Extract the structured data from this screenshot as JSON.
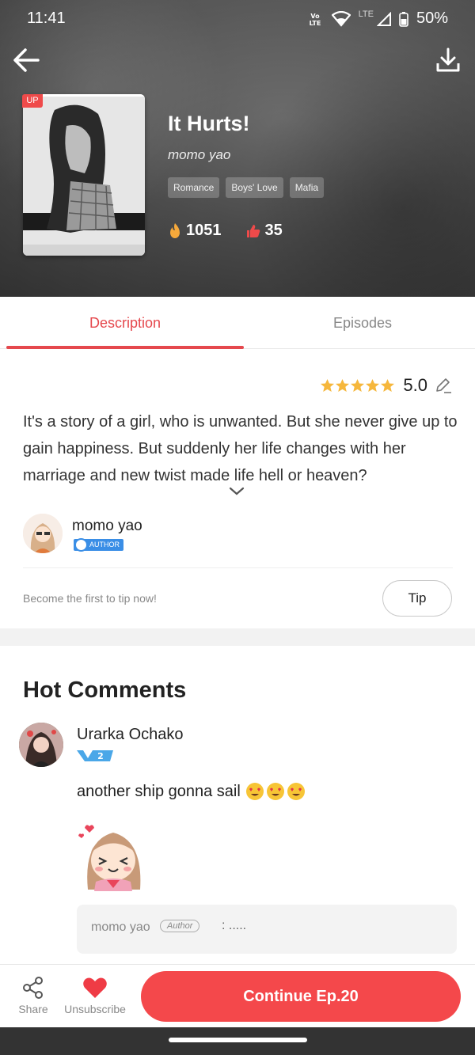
{
  "status": {
    "time": "11:41",
    "volte": "Vo LTE",
    "lte": "LTE",
    "battery": "50%"
  },
  "comic": {
    "badge": "UP",
    "title": "It Hurts!",
    "author": "momo yao",
    "tags": [
      "Romance",
      "Boys' Love",
      "Mafia"
    ],
    "popularity": "1051",
    "likes": "35"
  },
  "tabs": {
    "description": "Description",
    "episodes": "Episodes"
  },
  "description": {
    "rating": "5.0",
    "rating_stars": 5,
    "text": "It's a story of a girl, who is unwanted. But she never give up to gain happiness. But suddenly her life changes with her marriage and new twist made life hell or heaven?"
  },
  "author_info": {
    "name": "momo yao",
    "badge": "AUTHOR"
  },
  "tip": {
    "prompt": "Become the first to tip now!",
    "button": "Tip"
  },
  "comments": {
    "heading": "Hot Comments",
    "items": [
      {
        "user": "Urarka Ochako",
        "level": "2",
        "text": "another ship gonna sail",
        "emojis": 3,
        "reply": {
          "user": "momo yao",
          "badge": "Author",
          "text": ": ....."
        }
      }
    ]
  },
  "bottom": {
    "share": "Share",
    "unsubscribe": "Unsubscribe",
    "continue": "Continue Ep.20"
  },
  "colors": {
    "accent": "#f4484b",
    "tab_active": "#e5484d",
    "author_badge": "#3a8ee6",
    "star": "#f6b73c"
  }
}
